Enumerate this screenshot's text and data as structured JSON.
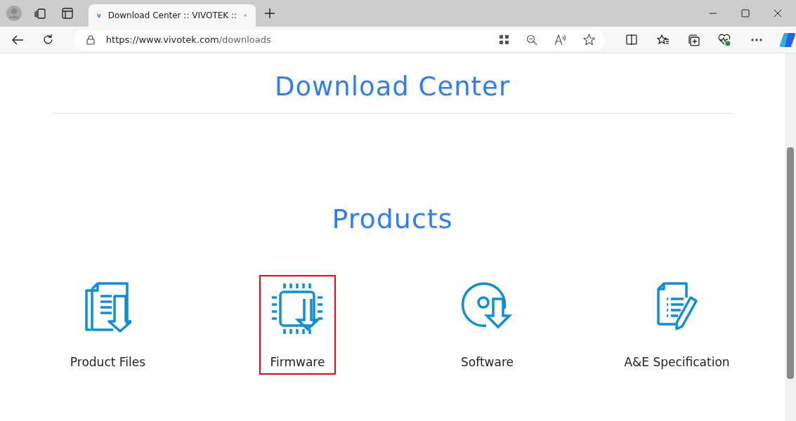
{
  "browser": {
    "tab_title": "Download Center :: VIVOTEK ::",
    "url_host": "https://www.vivotek.com",
    "url_path": "/downloads"
  },
  "page": {
    "title": "Download Center",
    "section_title": "Products",
    "products": [
      {
        "kind": "files",
        "label": "Product Files",
        "highlighted": false
      },
      {
        "kind": "firmware",
        "label": "Firmware",
        "highlighted": true
      },
      {
        "kind": "software",
        "label": "Software",
        "highlighted": false
      },
      {
        "kind": "spec",
        "label": "A&E Specification",
        "highlighted": false
      }
    ]
  }
}
